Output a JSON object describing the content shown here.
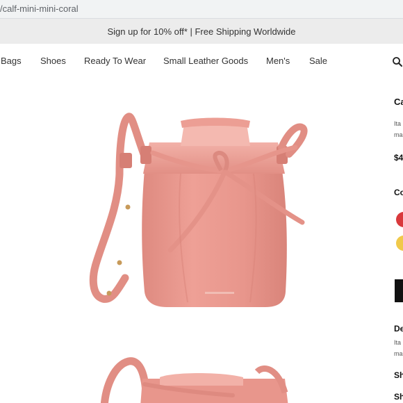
{
  "browser": {
    "url_text": "/calf-mini-mini-coral"
  },
  "promo": {
    "text": "Sign up for 10% off* | Free Shipping Worldwide"
  },
  "nav": {
    "items": [
      "Bags",
      "Shoes",
      "Ready To Wear",
      "Small Leather Goods",
      "Men's",
      "Sale"
    ],
    "search_icon": "search-icon"
  },
  "product": {
    "image_icon": "bucket-bag-image",
    "bag_color": "#e9958b",
    "title_partial": "Ca",
    "subtitle_partial_1": "Ita",
    "subtitle_partial_2": "ma",
    "price_partial": "$4",
    "color_label_partial": "Co",
    "swatches": [
      "#d9393c",
      "#f0c94a"
    ],
    "details_label_partial": "De",
    "details_text_1": "Ita",
    "details_text_2": "ma",
    "section_label_1": "Sh",
    "section_label_2": "Sh"
  },
  "colors": {
    "promo_bg": "#ececec",
    "urlbar_bg": "#f1f3f4",
    "button": "#111111"
  }
}
